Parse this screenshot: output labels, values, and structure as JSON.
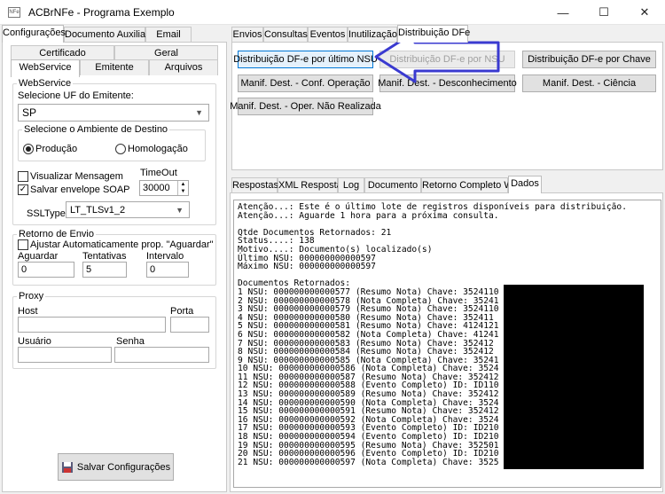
{
  "window": {
    "title": "ACBrNFe - Programa Exemplo",
    "icon_text": "NFe",
    "minimize": "—",
    "maximize": "☐",
    "close": "✕"
  },
  "left_tabs": [
    "Configurações",
    "Documento Auxiliar",
    "Email"
  ],
  "left_subtabs_row1": [
    "Certificado",
    "Geral"
  ],
  "left_subtabs_row2": [
    "WebService",
    "Emitente",
    "Arquivos"
  ],
  "webservice": {
    "group": "WebService",
    "uf_label": "Selecione UF do Emitente:",
    "uf_value": "SP",
    "ambiente_group": "Selecione o Ambiente de Destino",
    "producao": "Produção",
    "homologacao": "Homologação",
    "visualizar": "Visualizar Mensagem",
    "salvar_envelope": "Salvar envelope SOAP",
    "timeout_label": "TimeOut",
    "timeout_value": "30000",
    "ssltype_label": "SSLType",
    "ssltype_value": "LT_TLSv1_2"
  },
  "retorno": {
    "group": "Retorno de Envio",
    "ajustar": "Ajustar Automaticamente prop. \"Aguardar\"",
    "aguardar_label": "Aguardar",
    "aguardar_value": "0",
    "tentativas_label": "Tentativas",
    "tentativas_value": "5",
    "intervalo_label": "Intervalo",
    "intervalo_value": "0"
  },
  "proxy": {
    "group": "Proxy",
    "host": "Host",
    "porta": "Porta",
    "usuario": "Usuário",
    "senha": "Senha"
  },
  "save_button": "Salvar Configurações",
  "right_tabs": [
    "Envios",
    "Consultas",
    "Eventos",
    "Inutilização",
    "Distribuição DFe"
  ],
  "buttons": {
    "ult_nsu": "Distribuição DF-e por último NSU",
    "nsu": "Distribuição DF-e por NSU",
    "chave": "Distribuição DF-e por Chave",
    "conf_op": "Manif. Dest. - Conf. Operação",
    "desconhecimento": "Manif. Dest. - Desconhecimento",
    "ciencia": "Manif. Dest. - Ciência",
    "nao_realizada": "Manif. Dest. - Oper. Não Realizada"
  },
  "bottom_tabs": [
    "Respostas",
    "XML Resposta",
    "Log",
    "Documento",
    "Retorno Completo WS",
    "Dados"
  ],
  "memo_lines": [
    "Atenção...: Este é o último lote de registros disponíveis para distribuição.",
    "Atenção...: Aguarde 1 hora para a próxima consulta.",
    "",
    "Qtde Documentos Retornados: 21",
    "Status....: 138",
    "Motivo....: Documento(s) localizado(s)",
    "Último NSU: 000000000000597",
    "Máximo NSU: 000000000000597",
    "",
    "Documentos Retornados:",
    "1 NSU: 000000000000577 (Resumo Nota) Chave: 3524110",
    "2 NSU: 000000000000578 (Nota Completa) Chave: 35241",
    "3 NSU: 000000000000579 (Resumo Nota) Chave: 3524110",
    "4 NSU: 000000000000580 (Resumo Nota) Chave: 352411",
    "5 NSU: 000000000000581 (Resumo Nota) Chave: 4124121",
    "6 NSU: 000000000000582 (Nota Completa) Chave: 41241",
    "7 NSU: 000000000000583 (Resumo Nota) Chave: 352412",
    "8 NSU: 000000000000584 (Resumo Nota) Chave: 352412",
    "9 NSU: 000000000000585 (Nota Completa) Chave: 35241",
    "10 NSU: 000000000000586 (Nota Completa) Chave: 3524",
    "11 NSU: 000000000000587 (Resumo Nota) Chave: 352412",
    "12 NSU: 000000000000588 (Evento Completo) ID: ID110",
    "13 NSU: 000000000000589 (Resumo Nota) Chave: 352412",
    "14 NSU: 000000000000590 (Nota Completa) Chave: 3524",
    "15 NSU: 000000000000591 (Resumo Nota) Chave: 352412",
    "16 NSU: 000000000000592 (Nota Completa) Chave: 3524",
    "17 NSU: 000000000000593 (Evento Completo) ID: ID210",
    "18 NSU: 000000000000594 (Evento Completo) ID: ID210",
    "19 NSU: 000000000000595 (Resumo Nota) Chave: 352501",
    "20 NSU: 000000000000596 (Evento Completo) ID: ID210",
    "21 NSU: 000000000000597 (Nota Completa) Chave: 3525"
  ],
  "colors": {
    "arrow": "#3a3ad0",
    "focus": "#0078d7"
  }
}
